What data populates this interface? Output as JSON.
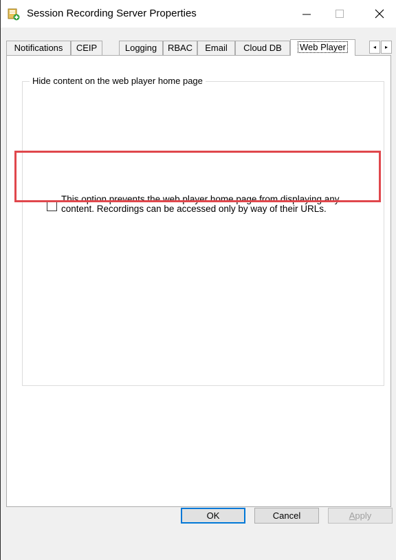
{
  "window": {
    "title": "Session Recording Server Properties",
    "icon": "server-properties-icon"
  },
  "titlebar_buttons": {
    "minimize": "minimize-icon",
    "maximize": "maximize-icon",
    "close": "close-icon"
  },
  "tabs": [
    {
      "label": "Notifications",
      "active": false
    },
    {
      "label": "CEIP",
      "active": false
    },
    {
      "label": "Logging",
      "active": false
    },
    {
      "label": "RBAC",
      "active": false
    },
    {
      "label": "Email",
      "active": false
    },
    {
      "label": "Cloud DB",
      "active": false
    },
    {
      "label": "Web Player",
      "active": true
    }
  ],
  "tab_scroll": {
    "left": "◂",
    "right": "▸"
  },
  "web_player": {
    "group_title": "Hide content on the web player home page",
    "option_checked": false,
    "option_text_line1": "This option prevents the web player home page from displaying any",
    "option_text_line2": "content. Recordings can be accessed only by way of their URLs."
  },
  "highlight_color": "#e0474c",
  "buttons": {
    "ok": "OK",
    "cancel": "Cancel",
    "apply_first": "A",
    "apply_rest": "pply"
  }
}
